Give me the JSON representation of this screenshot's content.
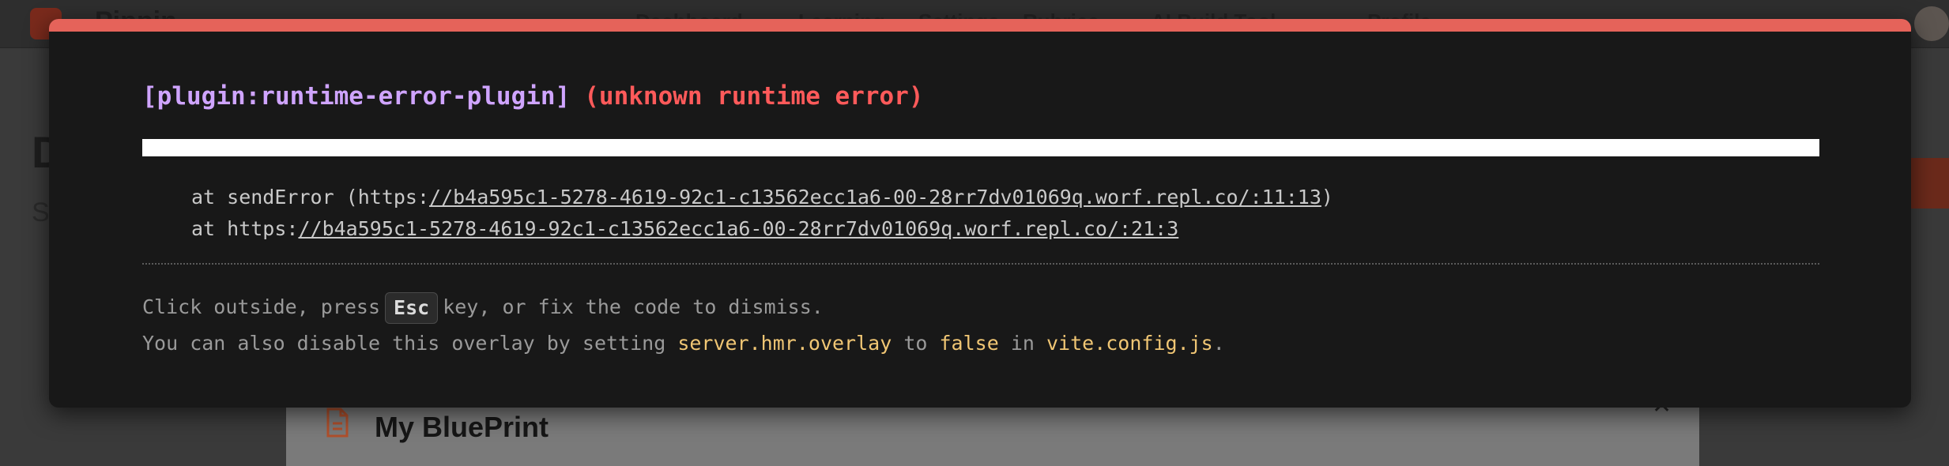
{
  "background": {
    "brand": "Pippin",
    "nav_items": [
      "Dashboard",
      "Learning",
      "Settings",
      "Rubrics",
      "AI Build Tool",
      "Profile"
    ],
    "page_title": "D",
    "page_subtitle": "S",
    "dialog_title": "My BluePrint",
    "dialog_close": "✕"
  },
  "overlay": {
    "plugin": "[plugin:runtime-error-plugin]",
    "message": "(unknown runtime error)",
    "stack": [
      {
        "prefix": "at sendError (https:",
        "link": "//b4a595c1-5278-4619-92c1-c13562ecc1a6-00-28rr7dv01069q.worf.repl.co/:11:13",
        "suffix": ")"
      },
      {
        "prefix": "at https:",
        "link": "//b4a595c1-5278-4619-92c1-c13562ecc1a6-00-28rr7dv01069q.worf.repl.co/:21:3",
        "suffix": ""
      }
    ],
    "tip_line1_a": "Click outside, press",
    "tip_key": "Esc",
    "tip_line1_b": "key, or fix the code to dismiss.",
    "tip_line2_a": "You can also disable this overlay by setting",
    "tip_code1": "server.hmr.overlay",
    "tip_line2_b": "to",
    "tip_code2": "false",
    "tip_line2_c": "in",
    "tip_code3": "vite.config.js",
    "tip_line2_d": "."
  },
  "colors": {
    "accent_bar": "#e5635a",
    "plugin": "#cfa4ff",
    "error": "#ff5a5a",
    "code": "#f0c674"
  }
}
